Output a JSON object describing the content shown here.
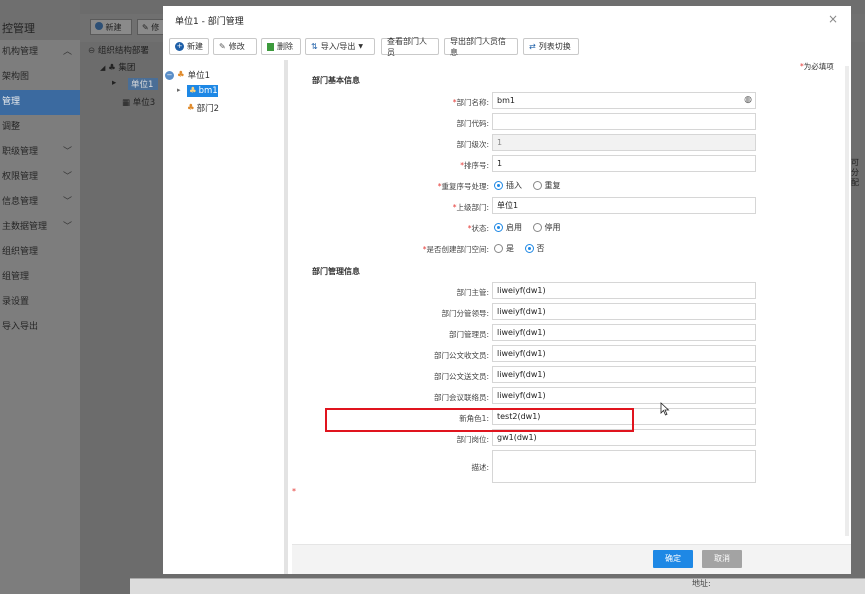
{
  "background": {
    "side_title": "控管理",
    "menu": [
      {
        "label": "机构管理",
        "chevron": true,
        "active": false
      },
      {
        "label": "架构图",
        "chevron": false,
        "active": false
      },
      {
        "label": "管理",
        "chevron": false,
        "active": true
      },
      {
        "label": "调整",
        "chevron": false,
        "active": false
      },
      {
        "label": "职级管理",
        "chevron": true,
        "active": false
      },
      {
        "label": "权限管理",
        "chevron": true,
        "active": false
      },
      {
        "label": "信息管理",
        "chevron": true,
        "active": false
      },
      {
        "label": "主数据管理",
        "chevron": true,
        "active": false
      },
      {
        "label": "组织管理",
        "chevron": false,
        "active": false
      },
      {
        "label": "组管理",
        "chevron": false,
        "active": false
      },
      {
        "label": "录设置",
        "chevron": false,
        "active": false
      },
      {
        "label": "导入导出",
        "chevron": false,
        "active": false
      }
    ],
    "toolbar": {
      "new_label": "新建",
      "second_label": "修"
    },
    "tree_root": "组织结构部署",
    "tree_group": "集团",
    "tree_unit1": "单位1",
    "tree_unit3": "单位3",
    "right_text_1": "可",
    "right_text_2": "分配",
    "bottom_label": "地址:"
  },
  "modal": {
    "title": "单位1 - 部门管理",
    "close": "×",
    "toolbar": {
      "new": "新建",
      "edit": "修改",
      "delete": "删除",
      "import_export": "导入/导出",
      "view_members": "查看部门人员",
      "export_members": "导出部门人员信息",
      "list_switch": "列表切换"
    },
    "tree": {
      "root": "单位1",
      "selected": "bm1",
      "child2": "部门2"
    },
    "required_note": "为必填项",
    "required_mark": "*",
    "section_basic": "部门基本信息",
    "section_manage": "部门管理信息",
    "fields": {
      "name": {
        "label": "部门名称:",
        "value": "bm1"
      },
      "code": {
        "label": "部门代码:",
        "value": ""
      },
      "level": {
        "label": "部门级次:",
        "value": "1"
      },
      "sort": {
        "label": "排序号:",
        "value": "1"
      },
      "dup_sort": {
        "label": "重复序号处理:",
        "opt1": "插入",
        "opt2": "重复"
      },
      "parent": {
        "label": "上级部门:",
        "value": "单位1"
      },
      "status": {
        "label": "状态:",
        "opt1": "启用",
        "opt2": "停用"
      },
      "create_space": {
        "label": "是否创建部门空间:",
        "opt1": "是",
        "opt2": "否"
      },
      "manager": {
        "label": "部门主管:",
        "value": "liweiyf(dw1)"
      },
      "leader": {
        "label": "部门分管领导:",
        "value": "liweiyf(dw1)"
      },
      "admin": {
        "label": "部门管理员:",
        "value": "liweiyf(dw1)"
      },
      "doc_receiver": {
        "label": "部门公文收文员:",
        "value": "liweiyf(dw1)"
      },
      "doc_sender": {
        "label": "部门公文送文员:",
        "value": "liweiyf(dw1)"
      },
      "meeting_liaison": {
        "label": "部门会议联络员:",
        "value": "liweiyf(dw1)"
      },
      "new_role": {
        "label": "新角色1:",
        "value": "test2(dw1)"
      },
      "post": {
        "label": "部门岗位:",
        "value": "gw1(dw1)"
      },
      "desc": {
        "label": "描述:",
        "value": ""
      }
    },
    "footer": {
      "ok": "确定",
      "cancel": "取消"
    }
  }
}
